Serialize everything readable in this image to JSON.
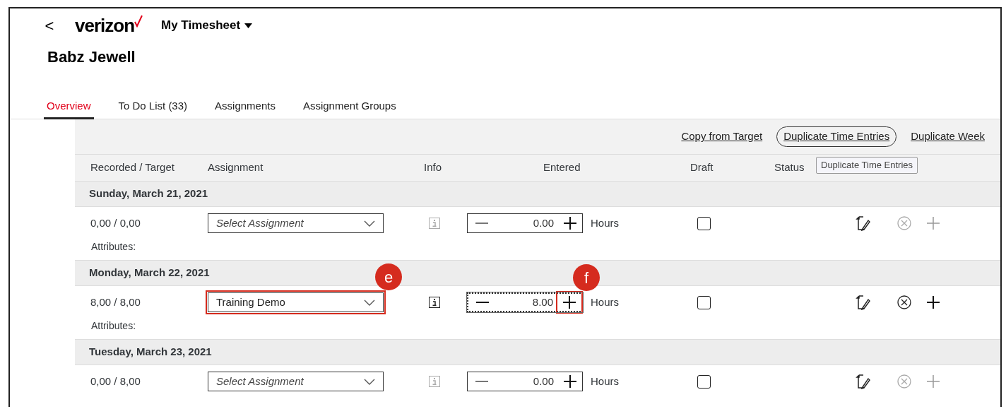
{
  "header": {
    "back": "<",
    "logo": "verizon",
    "app_title": "My Timesheet"
  },
  "employee": "Babz Jewell",
  "tabs": [
    {
      "label": "Overview",
      "selected": true
    },
    {
      "label": "To Do List (33)",
      "selected": false
    },
    {
      "label": "Assignments",
      "selected": false
    },
    {
      "label": "Assignment Groups",
      "selected": false
    }
  ],
  "actions": [
    {
      "label": "Copy from Target",
      "focused": false
    },
    {
      "label": "Duplicate Time Entries",
      "focused": true
    },
    {
      "label": "Duplicate Week",
      "focused": false
    }
  ],
  "tooltip": "Duplicate Time Entries",
  "columns": [
    "Recorded / Target",
    "Assignment",
    "Info",
    "Entered",
    "Draft",
    "Status"
  ],
  "days": [
    {
      "date": "Sunday, March 21, 2021",
      "entry": {
        "recorded": "0,00 / 0,00",
        "assignment": {
          "placeholder": "Select Assignment"
        },
        "info_enabled": false,
        "hours": "0.00",
        "focused": false,
        "unit": "Hours",
        "draft": false,
        "delete_enabled": false,
        "add_enabled": false,
        "attributes": "Attributes:"
      }
    },
    {
      "date": "Monday, March 22, 2021",
      "entry": {
        "recorded": "8,00 / 8,00",
        "assignment": {
          "value": "Training Demo",
          "callout": "e"
        },
        "info_enabled": true,
        "hours": "8.00",
        "focused": true,
        "increment_callout": "f",
        "unit": "Hours",
        "draft": false,
        "delete_enabled": true,
        "add_enabled": true,
        "attributes": "Attributes:"
      }
    },
    {
      "date": "Tuesday, March 23, 2021",
      "entry": {
        "recorded": "0,00 / 8,00",
        "assignment": {
          "placeholder": "Select Assignment"
        },
        "info_enabled": false,
        "hours": "0.00",
        "focused": false,
        "unit": "Hours",
        "draft": false,
        "delete_enabled": false,
        "add_enabled": false
      }
    }
  ]
}
